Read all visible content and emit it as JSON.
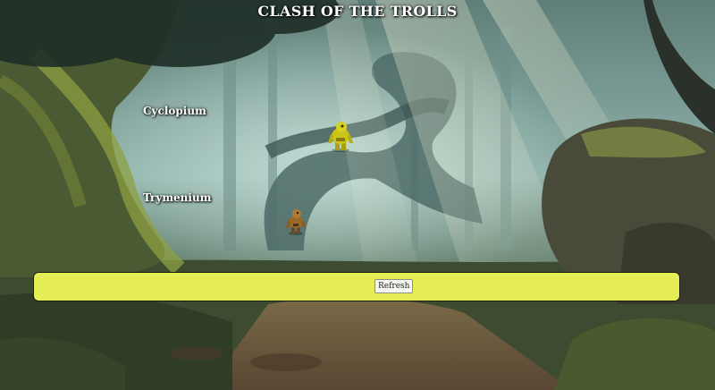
{
  "game": {
    "title": "CLASH OF THE TROLLS"
  },
  "trolls": [
    {
      "name": "Cyclopium",
      "sprite": "yellow-troll-icon",
      "color": "#c9c416"
    },
    {
      "name": "Trymenium",
      "sprite": "brown-troll-icon",
      "color": "#9a6a2a"
    }
  ],
  "controls": {
    "refresh_label": "Refresh",
    "bar_color": "#e5ee55"
  }
}
